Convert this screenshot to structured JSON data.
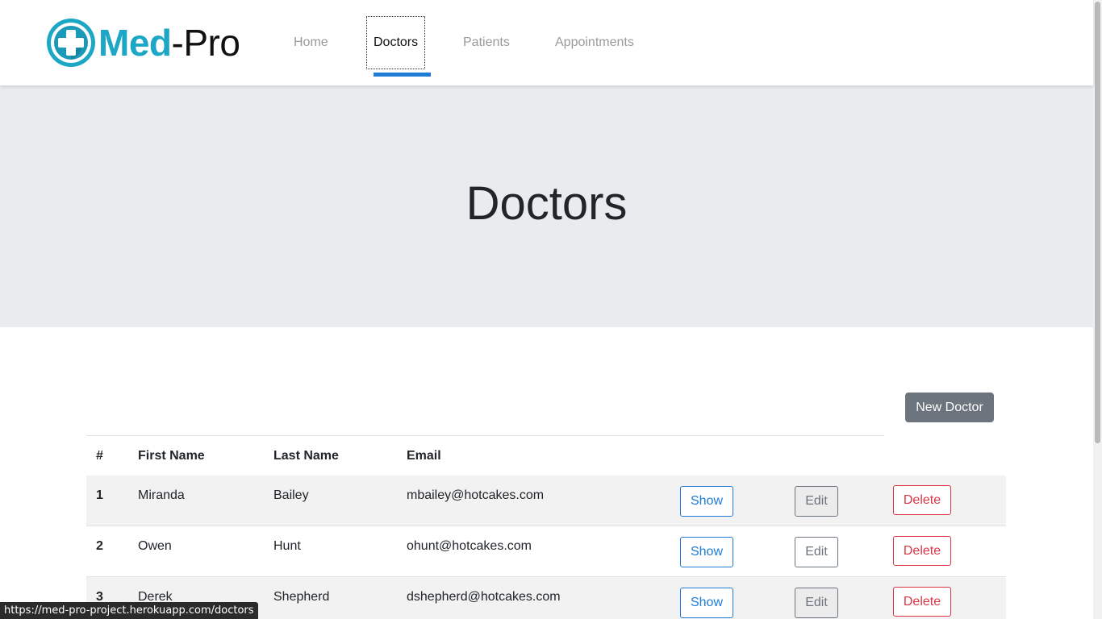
{
  "logo": {
    "med": "Med",
    "pro": "-Pro",
    "accent_color": "#1ba7c5"
  },
  "nav": {
    "items": [
      {
        "label": "Home"
      },
      {
        "label": "Doctors",
        "active": true
      },
      {
        "label": "Patients"
      },
      {
        "label": "Appointments"
      }
    ]
  },
  "hero": {
    "title": "Doctors"
  },
  "actions": {
    "new_doctor": "New Doctor"
  },
  "table": {
    "headers": [
      "#",
      "First Name",
      "Last Name",
      "Email"
    ],
    "rows": [
      {
        "num": "1",
        "first": "Miranda",
        "last": "Bailey",
        "email": "mbailey@hotcakes.com",
        "show": "Show",
        "edit": "Edit",
        "delete": "Delete"
      },
      {
        "num": "2",
        "first": "Owen",
        "last": "Hunt",
        "email": "ohunt@hotcakes.com",
        "show": "Show",
        "edit": "Edit",
        "delete": "Delete"
      },
      {
        "num": "3",
        "first": "Derek",
        "last": "Shepherd",
        "email": "dshepherd@hotcakes.com",
        "show": "Show",
        "edit": "Edit",
        "delete": "Delete"
      }
    ]
  },
  "statusbar": {
    "url": "https://med-pro-project.herokuapp.com/doctors"
  },
  "colors": {
    "primary": "#1f7bd6",
    "danger": "#dc3545",
    "secondary": "#6c757d",
    "hero_bg": "#e9ecef"
  }
}
